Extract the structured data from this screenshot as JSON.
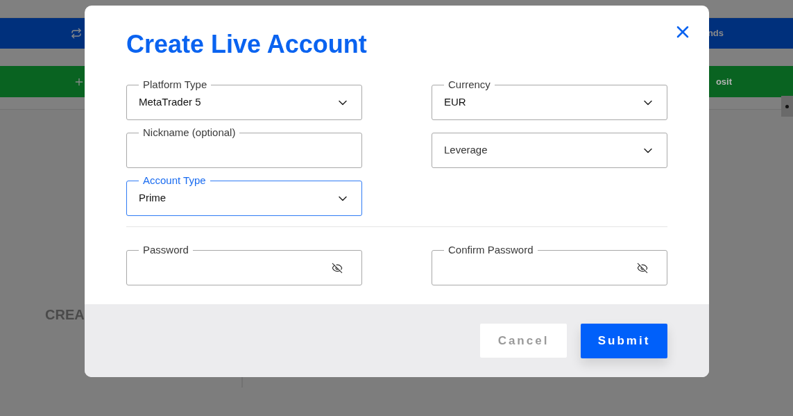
{
  "background": {
    "funds_bar": {
      "text": "nds"
    },
    "deposit_bar": {
      "text": "osit"
    },
    "heading": "CREA"
  },
  "dialog": {
    "title": "Create Live Account",
    "left_fields": [
      {
        "kind": "select",
        "label": "Platform Type",
        "value": "MetaTrader 5",
        "focused": false
      },
      {
        "kind": "text",
        "label": "Nickname (optional)",
        "focused": false
      },
      {
        "kind": "select",
        "label": "Account Type",
        "value": "Prime",
        "focused": true
      }
    ],
    "right_fields": [
      {
        "kind": "select",
        "label": "Currency",
        "value": "EUR",
        "focused": false
      },
      {
        "kind": "select",
        "placeholder": "Leverage",
        "focused": false
      }
    ],
    "password_fields": [
      {
        "kind": "password",
        "label": "Password",
        "focused": false
      },
      {
        "kind": "password",
        "label": "Confirm Password",
        "focused": false
      }
    ],
    "buttons": [
      {
        "kind": "secondary",
        "label": "Cancel"
      },
      {
        "kind": "primary",
        "label": "Submit"
      }
    ]
  }
}
